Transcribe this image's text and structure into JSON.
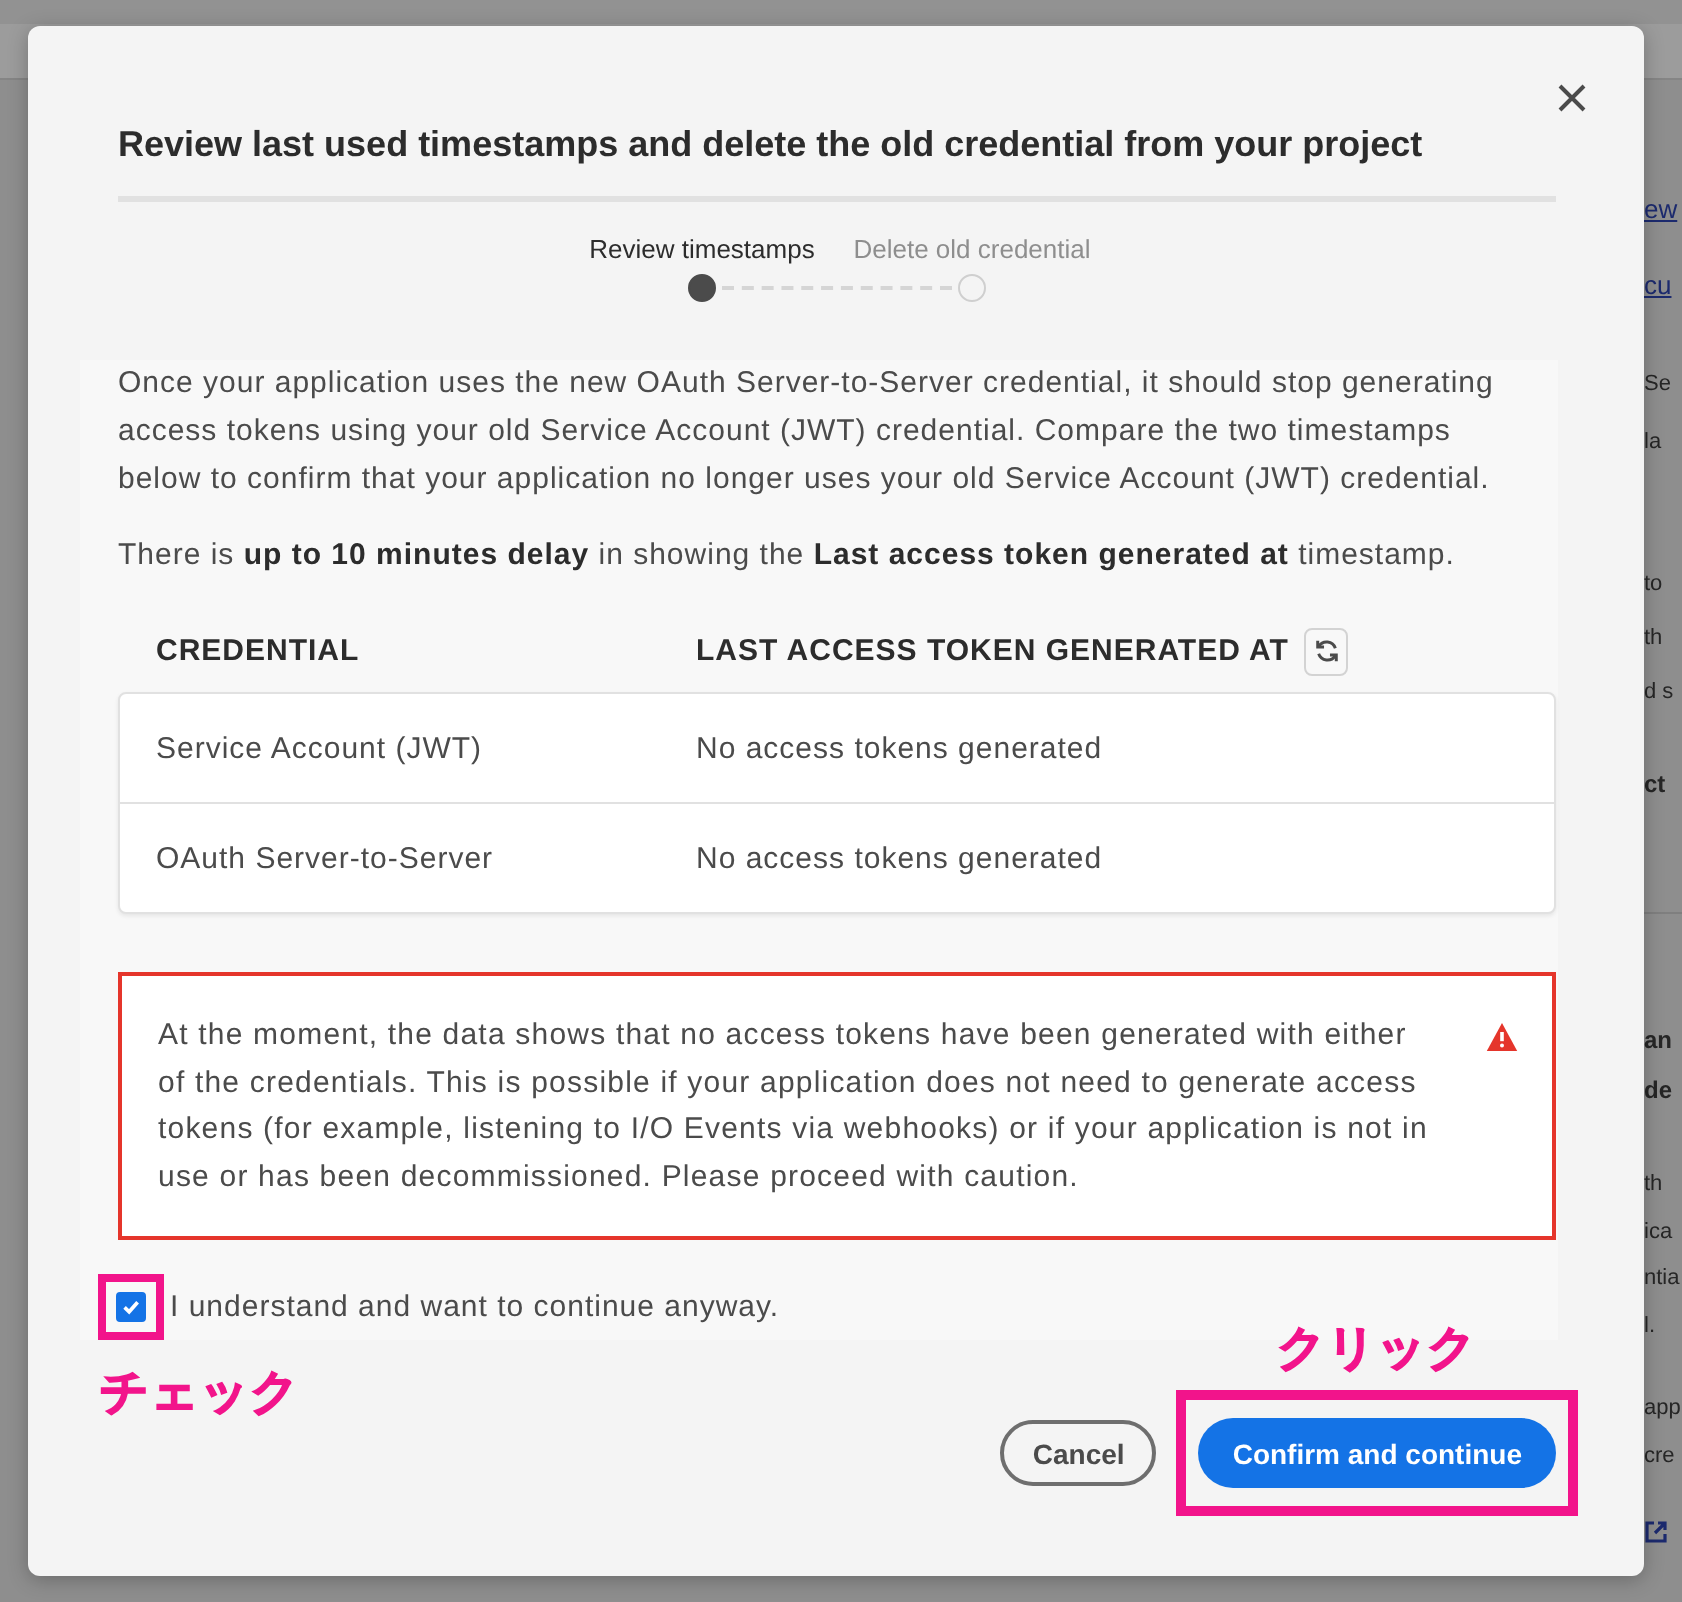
{
  "page_background": {
    "right_edge_fragments": [
      {
        "kind": "link",
        "lines": [
          "ew",
          "cu"
        ]
      },
      {
        "kind": "text",
        "lines": [
          "Se",
          "la"
        ]
      },
      {
        "kind": "text",
        "lines": [
          "to",
          "th",
          "d s"
        ]
      },
      {
        "kind": "bold",
        "lines": [
          "ct"
        ]
      },
      {
        "kind": "heading",
        "lines": [
          "an",
          "de"
        ]
      },
      {
        "kind": "text",
        "lines": [
          "th",
          "ica",
          "ntia",
          "l."
        ]
      },
      {
        "kind": "text",
        "lines": [
          "app",
          "cre"
        ]
      }
    ]
  },
  "dialog": {
    "title": "Review last used timestamps and delete the old credential from your project",
    "steps": [
      {
        "label": "Review timestamps",
        "selected": true
      },
      {
        "label": "Delete old credential",
        "selected": false
      }
    ],
    "intro": "Once your application uses the new OAuth Server-to-Server credential, it should stop generating access tokens using your old Service Account (JWT) credential. Compare the two timestamps below to confirm that your application no longer uses your old Service Account (JWT) credential.",
    "note": "There is **up to 10 minutes delay** in showing the **Last access token generated at** timestamp.",
    "table": {
      "columns": [
        "CREDENTIAL",
        "LAST ACCESS TOKEN GENERATED AT"
      ],
      "rows": [
        [
          "Service Account (JWT)",
          "No access tokens generated"
        ],
        [
          "OAuth Server-to-Server",
          "No access tokens generated"
        ]
      ]
    },
    "warning": "At the moment, the data shows that no access tokens have been generated with either of the credentials. This is possible if your application does not need to generate access tokens (for example, listening to I/O Events via webhooks) or if your application is not in use or has been decommissioned. Please proceed with caution.",
    "confirmation": {
      "label": "I understand and want to continue anyway.",
      "checked": true,
      "highlighted": true,
      "annotation": "チェック"
    },
    "buttons": [
      {
        "label": "Cancel",
        "kind": "secondary",
        "highlighted": false
      },
      {
        "label": "Confirm and continue",
        "kind": "primary",
        "highlighted": true,
        "annotation": "クリック"
      }
    ]
  }
}
